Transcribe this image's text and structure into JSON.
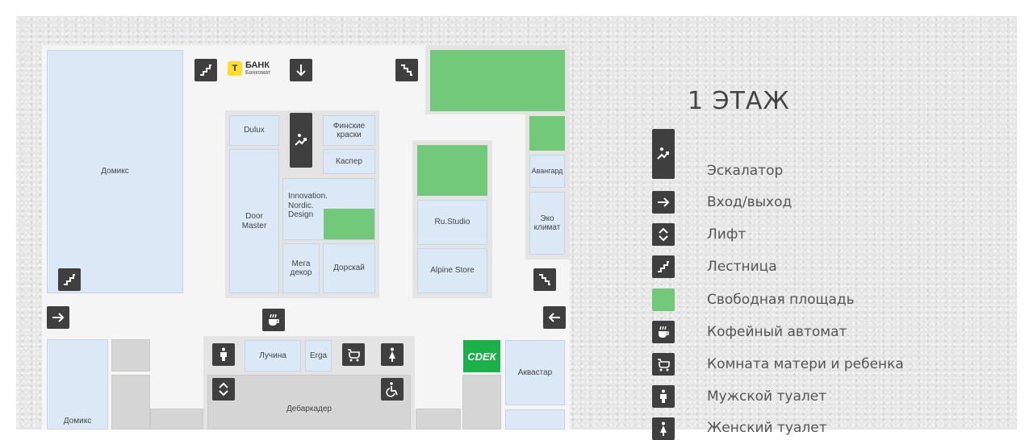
{
  "floor_title": "1 ЭТАЖ",
  "bank": {
    "name": "БАНК",
    "sub": "Банкомат",
    "logo_letter": "Т"
  },
  "cdek_logo": "СDЕК",
  "shops": {
    "domiks_top": "Домикс",
    "domiks_bottom": "Домикс",
    "dulux": "Dulux",
    "finskie": "Финские\nкраски",
    "kasper": "Каспер",
    "door_master": "Door\nMaster",
    "innovation": "Innovation.\nNordic.\nDesign",
    "mega_dekor": "Мега\nдекор",
    "dorskay": "Дорскай",
    "ru_studio": "Ru.Studio",
    "alpine": "Alpine Store",
    "avangard": "Авангард",
    "eko": "Эко\nклимат",
    "luchina": "Лучина",
    "erga": "Erga",
    "debarkader": "Дебаркадер",
    "akvastar": "Аквастар"
  },
  "legend": [
    {
      "icon": "escalator-icon",
      "label": "Эскалатор"
    },
    {
      "icon": "entrance-exit-arrow-icon",
      "label": "Вход/выход"
    },
    {
      "icon": "elevator-icon",
      "label": "Лифт"
    },
    {
      "icon": "stairs-icon",
      "label": "Лестница"
    },
    {
      "icon": "free-area-swatch",
      "label": "Свободная площадь"
    },
    {
      "icon": "coffee-machine-icon",
      "label": "Кофейный автомат"
    },
    {
      "icon": "mother-child-room-icon",
      "label": "Комната матери и ребенка"
    },
    {
      "icon": "mens-toilet-icon",
      "label": "Мужской туалет"
    },
    {
      "icon": "womens-toilet-icon",
      "label": "Женский туалет"
    }
  ],
  "colors": {
    "shop": "#dbe9f7",
    "free_area": "#72c979",
    "icon_bg": "#3f3f3f",
    "cdek": "#1ab248",
    "bank_yellow": "#ffdd2d"
  }
}
